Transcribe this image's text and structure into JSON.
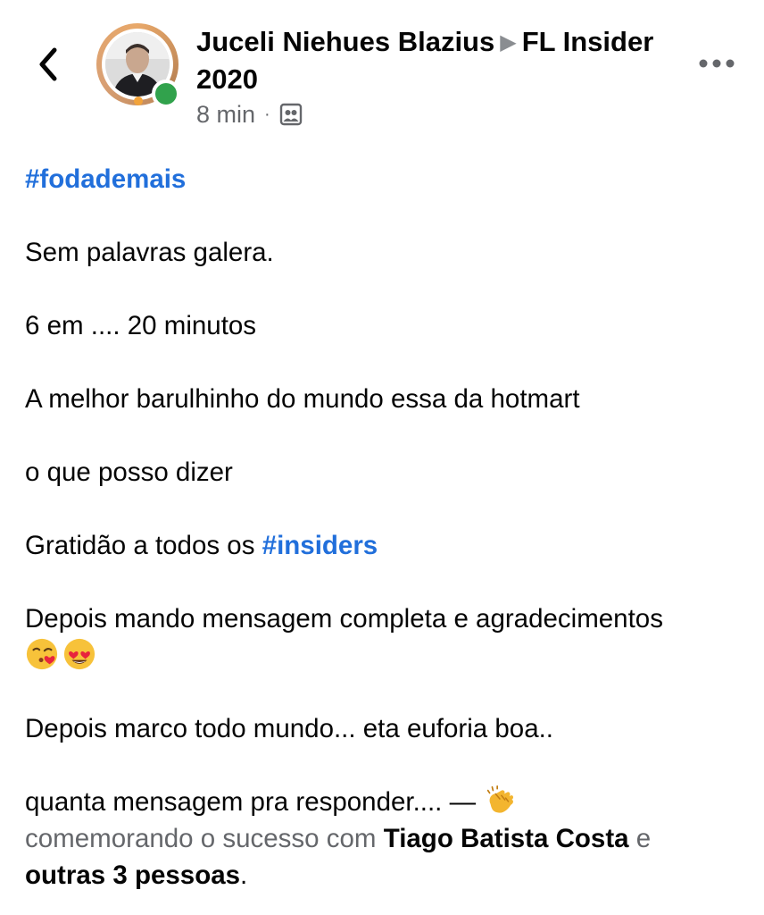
{
  "header": {
    "author": "Juceli Niehues Blazius",
    "group": "FL Insider 2020",
    "time": "8 min",
    "separator": "·"
  },
  "post": {
    "hashtag_top": "#fodademais",
    "line1": "Sem palavras galera.",
    "line2": "6 em .... 20 minutos",
    "line3": "A melhor barulhinho do mundo essa da hotmart",
    "line4": "o que posso dizer",
    "line5_prefix": "Gratidão a todos os ",
    "line5_hashtag": "#insiders",
    "line6": "Depois mando mensagem completa e agradecimentos",
    "line7": "Depois marco todo mundo... eta euforia boa..",
    "line8": "quanta mensagem pra responder.... —",
    "activity": "comemorando o sucesso com",
    "tagged_person": "Tiago Batista Costa",
    "conjunction": "e",
    "others": "outras 3 pessoas",
    "period": "."
  },
  "icons": {
    "back": "chevron-left-icon",
    "more": "more-horizontal-icon",
    "audience": "group-audience-icon",
    "emoji_kiss": "kissing-heart-emoji",
    "emoji_love": "heart-eyes-emoji",
    "emoji_clap": "clapping-hands-emoji"
  },
  "colors": {
    "hashtag": "#216fdb",
    "online": "#31a24c",
    "meta_gray": "#65676b"
  }
}
